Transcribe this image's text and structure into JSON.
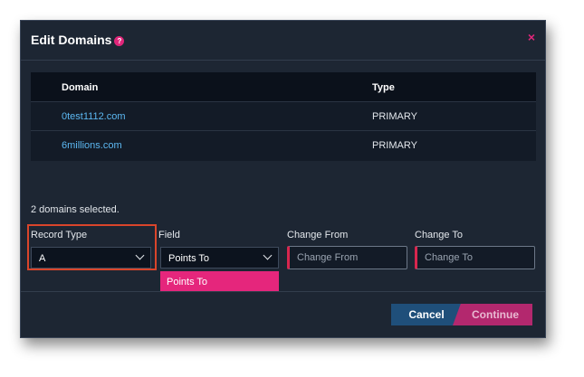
{
  "dialog": {
    "title": "Edit Domains",
    "help_icon": "?",
    "close_icon": "×"
  },
  "table": {
    "headers": {
      "domain": "Domain",
      "type": "Type"
    },
    "rows": [
      {
        "domain": "0test1112.com",
        "type": "PRIMARY"
      },
      {
        "domain": "6millions.com",
        "type": "PRIMARY"
      }
    ]
  },
  "selection": {
    "count_text": "2 domains selected."
  },
  "form": {
    "record_type": {
      "label": "Record Type",
      "value": "A"
    },
    "field": {
      "label": "Field",
      "value": "Points To",
      "options": [
        "Points To"
      ]
    },
    "change_from": {
      "label": "Change From",
      "placeholder": "Change From"
    },
    "change_to": {
      "label": "Change To",
      "placeholder": "Change To"
    }
  },
  "buttons": {
    "cancel": "Cancel",
    "continue": "Continue"
  },
  "colors": {
    "dialog_bg": "#1d2633",
    "accent_pink": "#e0267a",
    "link_blue": "#5cb8f2",
    "cancel_bg": "#1f4f7a",
    "continue_bg": "#b3286e",
    "highlight_red": "#d9452b"
  }
}
